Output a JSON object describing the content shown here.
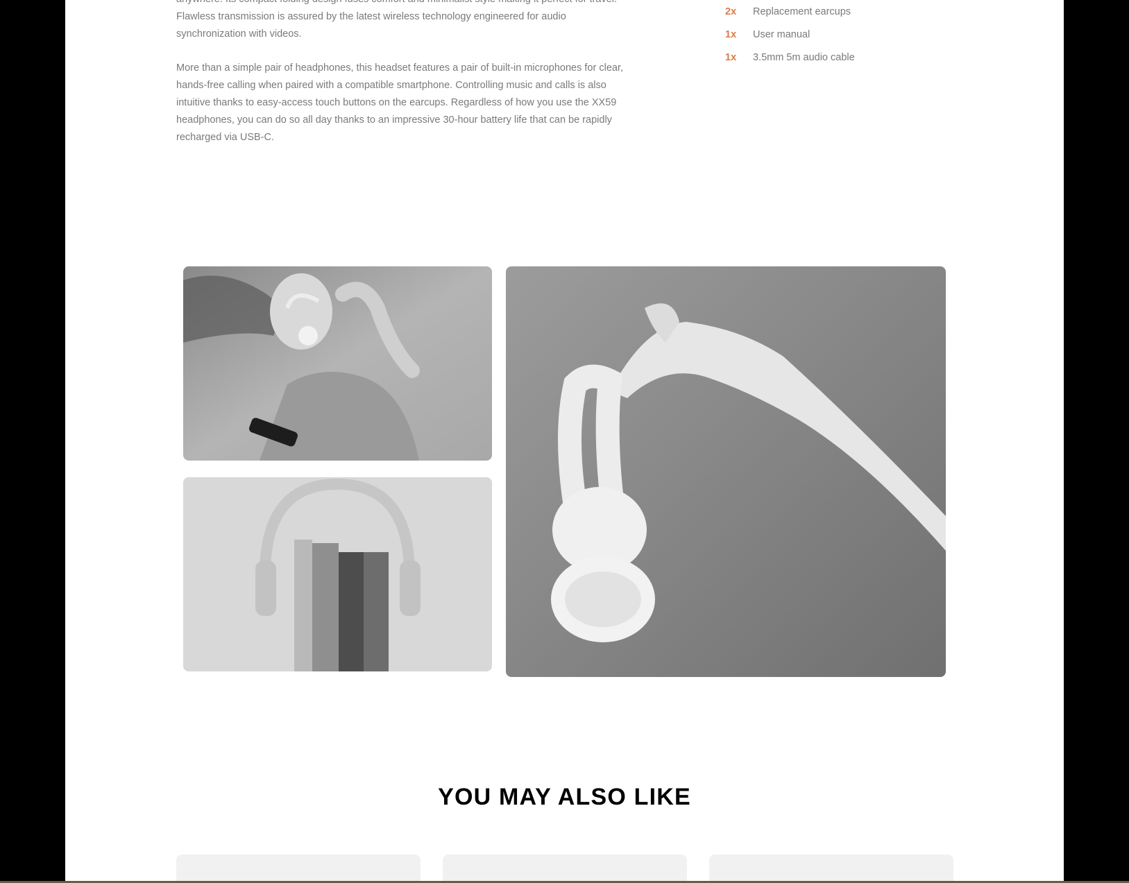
{
  "features": {
    "paragraph_1": "anywhere. Its compact folding design fuses comfort and minimalist style making it perfect for travel. Flawless transmission is assured by the latest wireless technology engineered for audio synchronization with videos.",
    "paragraph_2": "More than a simple pair of headphones, this headset features a pair of built-in microphones for clear, hands-free calling when paired with a compatible smartphone. Controlling music and calls is also intuitive thanks to easy-access touch buttons on the earcups. Regardless of how you use the XX59 headphones, you can do so all day thanks to an impressive 30-hour battery life that can be rapidly recharged via USB-C."
  },
  "in_the_box": [
    {
      "qty": "2x",
      "item": "Replacement earcups"
    },
    {
      "qty": "1x",
      "item": "User manual"
    },
    {
      "qty": "1x",
      "item": "3.5mm 5m audio cable"
    }
  ],
  "gallery": {
    "images": [
      "woman-dancing-with-headphones",
      "headphones-on-books",
      "hand-holding-headphones"
    ]
  },
  "also_like": {
    "title": "YOU MAY ALSO LIKE"
  },
  "colors": {
    "accent": "#d87d4a",
    "body_text": "#7a7a7a",
    "card_bg": "#f1f1f1"
  }
}
